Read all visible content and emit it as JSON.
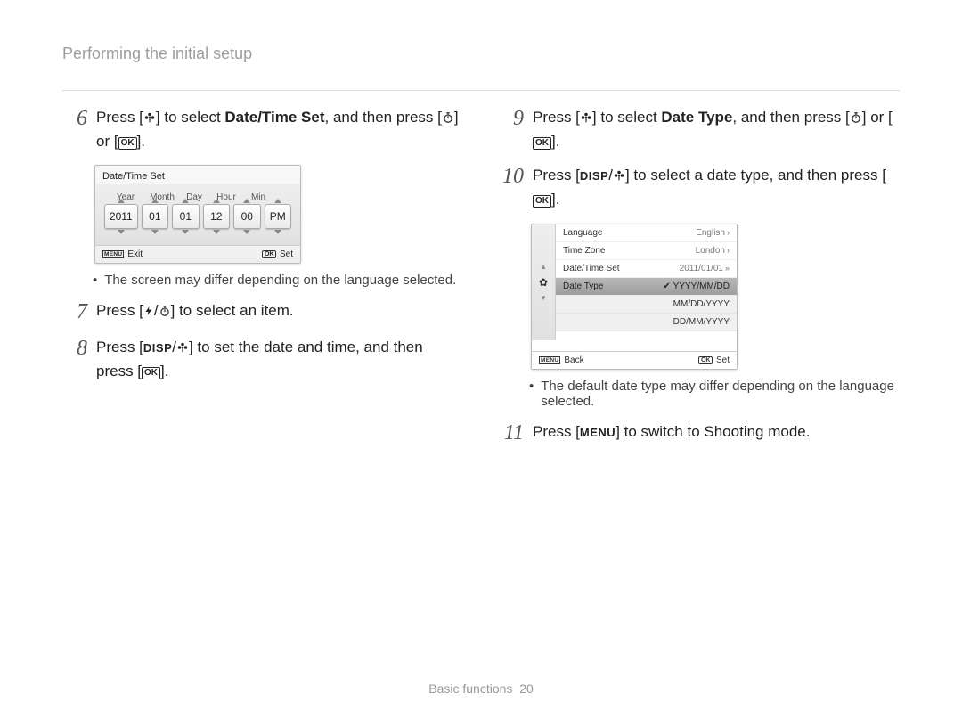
{
  "header": "Performing the initial setup",
  "steps": {
    "s6": {
      "num": "6",
      "pre": "Press [",
      "mid1": "] to select ",
      "bold": "Date/Time Set",
      "mid2": ", and then press [",
      "mid3": "] or [",
      "end": "]."
    },
    "s6_note": "The screen may differ depending on the language selected.",
    "s7": {
      "num": "7",
      "pre": "Press [",
      "mid": "] to select an item."
    },
    "s8": {
      "num": "8",
      "pre": "Press [",
      "mid": "] to set the date and time, and then press [",
      "end": "]."
    },
    "s9": {
      "num": "9",
      "pre": "Press [",
      "mid1": "] to select ",
      "bold": "Date Type",
      "mid2": ", and then press [",
      "mid3": "] or [",
      "end": "]."
    },
    "s10": {
      "num": "10",
      "pre": "Press [",
      "mid": "] to select a date type, and then press [",
      "end": "]."
    },
    "s10_note": "The default date type may differ depending on the language selected.",
    "s11": {
      "num": "11",
      "pre": "Press [",
      "mid": "] to switch to Shooting mode."
    }
  },
  "glyph_labels": {
    "disp": "DISP",
    "ok": "OK",
    "menu": "MENU"
  },
  "screen1": {
    "title": "Date/Time Set",
    "labels": {
      "year": "Year",
      "month": "Month",
      "day": "Day",
      "hour": "Hour",
      "min": "Min"
    },
    "values": {
      "year": "2011",
      "month": "01",
      "day": "01",
      "hour": "12",
      "min": "00",
      "ampm": "PM"
    },
    "footer": {
      "exit": "Exit",
      "set": "Set",
      "menu": "MENU",
      "ok": "OK"
    }
  },
  "screen2": {
    "rows": {
      "language": {
        "label": "Language",
        "value": "English"
      },
      "timezone": {
        "label": "Time Zone",
        "value": "London"
      },
      "datetime": {
        "label": "Date/Time Set",
        "value": "2011/01/01"
      },
      "datetype": {
        "label": "Date Type",
        "value": "YYYY/MM/DD"
      }
    },
    "options": {
      "o1": "YYYY/MM/DD",
      "o2": "MM/DD/YYYY",
      "o3": "DD/MM/YYYY"
    },
    "footer": {
      "back": "Back",
      "set": "Set",
      "menu": "MENU",
      "ok": "OK"
    }
  },
  "footer": {
    "section": "Basic functions",
    "page": "20"
  }
}
